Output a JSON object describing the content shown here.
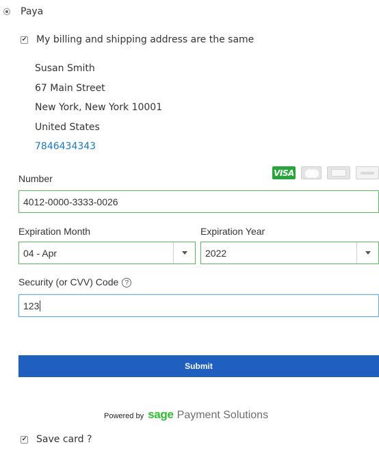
{
  "payment_method": {
    "label": "Paya",
    "selected": true
  },
  "billing_same": {
    "label": "My billing and shipping address are the same",
    "checked": true
  },
  "address": {
    "name": "Susan Smith",
    "street": "67 Main Street",
    "city_state_zip": "New York, New York 10001",
    "country": "United States",
    "phone": "7846434343"
  },
  "card_logos": [
    {
      "name": "VISA",
      "icon": "visa-icon",
      "color": "#27a53b"
    },
    {
      "name": "MasterCard",
      "icon": "mastercard-icon"
    },
    {
      "name": "American Express",
      "icon": "amex-icon"
    },
    {
      "name": "Discover",
      "icon": "discover-icon"
    }
  ],
  "form": {
    "number_label": "Number",
    "number_value": "4012-0000-3333-0026",
    "exp_month_label": "Expiration Month",
    "exp_month_value": "04 - Apr",
    "exp_year_label": "Expiration Year",
    "exp_year_value": "2022",
    "cvv_label": "Security (or CVV) Code",
    "cvv_value": "123",
    "help_glyph": "?"
  },
  "submit": {
    "label": "Submit",
    "color": "#1f5fbf"
  },
  "powered_by": {
    "prefix": "Powered by",
    "brand": "sage",
    "suffix": "Payment Solutions",
    "brand_color": "#2fbe2f"
  },
  "save_card": {
    "label": "Save card ?",
    "checked": true
  },
  "colors": {
    "valid_border": "#5cb85c",
    "focus_border": "#68a9dc",
    "link": "#1979c3"
  }
}
